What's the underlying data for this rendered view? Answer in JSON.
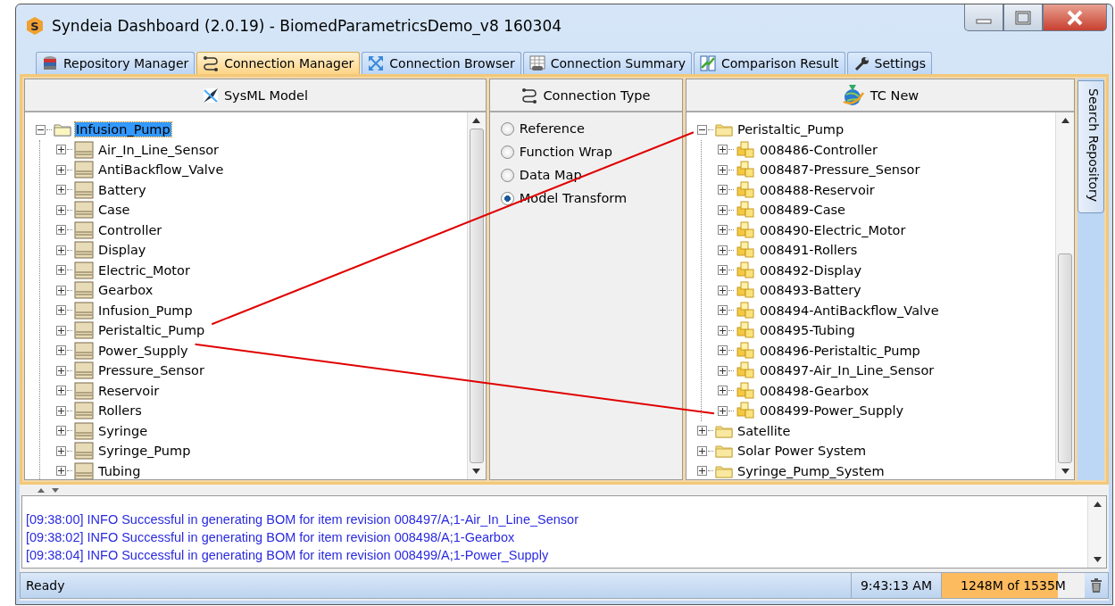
{
  "window": {
    "icon_letter": "S",
    "title": "Syndeia Dashboard (2.0.19) - BiomedParametricsDemo_v8 160304"
  },
  "tabs": [
    {
      "label": "Repository Manager",
      "selected": false
    },
    {
      "label": "Connection Manager",
      "selected": true
    },
    {
      "label": "Connection Browser",
      "selected": false
    },
    {
      "label": "Connection Summary",
      "selected": false
    },
    {
      "label": "Comparison Result",
      "selected": false
    },
    {
      "label": "Settings",
      "selected": false
    }
  ],
  "sysml_panel": {
    "title": "SysML Model",
    "tree": [
      {
        "label": "Infusion_Pump",
        "expanded": true,
        "selected": true,
        "linked": false,
        "children": [
          {
            "label": "Air_In_Line_Sensor",
            "expanded": false,
            "selected": false,
            "linked": false
          },
          {
            "label": "AntiBackflow_Valve",
            "expanded": false,
            "selected": false,
            "linked": false
          },
          {
            "label": "Battery",
            "expanded": false,
            "selected": false,
            "linked": false
          },
          {
            "label": "Case",
            "expanded": false,
            "selected": false,
            "linked": false
          },
          {
            "label": "Controller",
            "expanded": false,
            "selected": false,
            "linked": false
          },
          {
            "label": "Display",
            "expanded": false,
            "selected": false,
            "linked": false
          },
          {
            "label": "Electric_Motor",
            "expanded": false,
            "selected": false,
            "linked": false
          },
          {
            "label": "Gearbox",
            "expanded": false,
            "selected": false,
            "linked": false
          },
          {
            "label": "Infusion_Pump",
            "expanded": false,
            "selected": false,
            "linked": false
          },
          {
            "label": "Peristaltic_Pump",
            "expanded": false,
            "selected": false,
            "linked": true
          },
          {
            "label": "Power_Supply",
            "expanded": false,
            "selected": false,
            "linked": true
          },
          {
            "label": "Pressure_Sensor",
            "expanded": false,
            "selected": false,
            "linked": false
          },
          {
            "label": "Reservoir",
            "expanded": false,
            "selected": false,
            "linked": false
          },
          {
            "label": "Rollers",
            "expanded": false,
            "selected": false,
            "linked": false
          },
          {
            "label": "Syringe",
            "expanded": false,
            "selected": false,
            "linked": false
          },
          {
            "label": "Syringe_Pump",
            "expanded": false,
            "selected": false,
            "linked": false
          },
          {
            "label": "Tubing",
            "expanded": false,
            "selected": false,
            "linked": false
          }
        ]
      }
    ]
  },
  "connection_type_panel": {
    "title": "Connection Type",
    "options": [
      {
        "label": "Reference",
        "selected": false
      },
      {
        "label": "Function Wrap",
        "selected": false
      },
      {
        "label": "Data Map",
        "selected": false
      },
      {
        "label": "Model Transform",
        "selected": true
      }
    ]
  },
  "tc_panel": {
    "title": "TC New",
    "tree": [
      {
        "label": "Peristaltic_Pump",
        "expanded": true,
        "selected": false,
        "linked": true,
        "children": [
          {
            "label": "008486-Controller",
            "expanded": false,
            "selected": false,
            "linked": false
          },
          {
            "label": "008487-Pressure_Sensor",
            "expanded": false,
            "selected": false,
            "linked": false
          },
          {
            "label": "008488-Reservoir",
            "expanded": false,
            "selected": false,
            "linked": false
          },
          {
            "label": "008489-Case",
            "expanded": false,
            "selected": false,
            "linked": false
          },
          {
            "label": "008490-Electric_Motor",
            "expanded": false,
            "selected": false,
            "linked": false
          },
          {
            "label": "008491-Rollers",
            "expanded": false,
            "selected": false,
            "linked": false
          },
          {
            "label": "008492-Display",
            "expanded": false,
            "selected": false,
            "linked": false
          },
          {
            "label": "008493-Battery",
            "expanded": false,
            "selected": false,
            "linked": false
          },
          {
            "label": "008494-AntiBackflow_Valve",
            "expanded": false,
            "selected": false,
            "linked": false
          },
          {
            "label": "008495-Tubing",
            "expanded": false,
            "selected": false,
            "linked": false
          },
          {
            "label": "008496-Peristaltic_Pump",
            "expanded": false,
            "selected": false,
            "linked": false
          },
          {
            "label": "008497-Air_In_Line_Sensor",
            "expanded": false,
            "selected": false,
            "linked": false
          },
          {
            "label": "008498-Gearbox",
            "expanded": false,
            "selected": false,
            "linked": false
          },
          {
            "label": "008499-Power_Supply",
            "expanded": false,
            "selected": false,
            "linked": true
          }
        ]
      },
      {
        "label": "Satellite",
        "expanded": false,
        "selected": false,
        "linked": false
      },
      {
        "label": "Solar Power System",
        "expanded": false,
        "selected": false,
        "linked": false
      },
      {
        "label": "Syringe_Pump_System",
        "expanded": false,
        "selected": false,
        "linked": false
      }
    ]
  },
  "side_tab": {
    "label": "Search Repository"
  },
  "log": {
    "lines": [
      "[09:38:00] INFO Successful in generating BOM for item revision 008497/A;1-Air_In_Line_Sensor",
      "[09:38:02] INFO Successful in generating BOM for item revision 008498/A;1-Gearbox",
      "[09:38:04] INFO Successful in generating BOM for item revision 008499/A;1-Power_Supply"
    ]
  },
  "status_bar": {
    "message": "Ready",
    "time": "9:43:13 AM",
    "memory": {
      "label": "1248M of 1535M",
      "level": 0.81
    }
  }
}
